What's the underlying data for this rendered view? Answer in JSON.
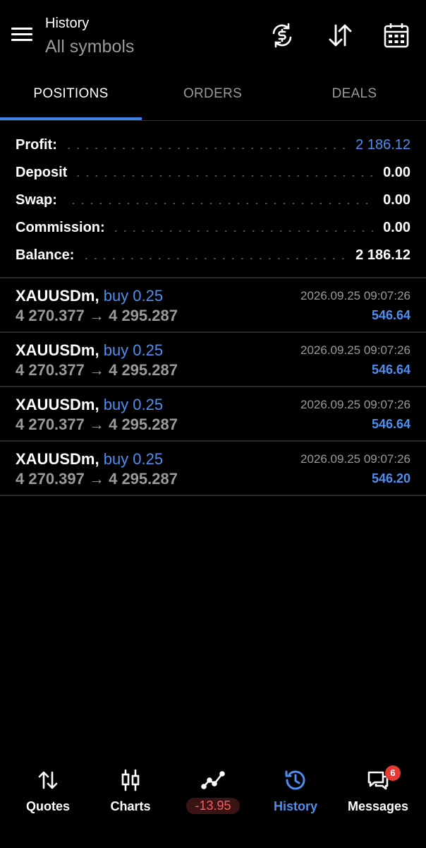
{
  "header": {
    "title": "History",
    "subtitle": "All symbols",
    "icons": [
      "menu-icon",
      "currency-exchange-icon",
      "sort-icon",
      "calendar-icon"
    ]
  },
  "tabs": [
    {
      "label": "POSITIONS",
      "active": true
    },
    {
      "label": "ORDERS",
      "active": false
    },
    {
      "label": "DEALS",
      "active": false
    }
  ],
  "summary": {
    "profit": {
      "label": "Profit:",
      "value": "2 186.12"
    },
    "deposit": {
      "label": "Deposit",
      "value": "0.00"
    },
    "swap": {
      "label": "Swap:",
      "value": "0.00"
    },
    "commission": {
      "label": "Commission:",
      "value": "0.00"
    },
    "balance": {
      "label": "Balance:",
      "value": "2 186.12"
    }
  },
  "positions": [
    {
      "symbol": "XAUUSDm,",
      "side": "buy 0.25",
      "prices": "4 270.377 → 4 295.287",
      "time": "2026.09.25 09:07:26",
      "profit": "546.64"
    },
    {
      "symbol": "XAUUSDm,",
      "side": "buy 0.25",
      "prices": "4 270.377 → 4 295.287",
      "time": "2026.09.25 09:07:26",
      "profit": "546.64"
    },
    {
      "symbol": "XAUUSDm,",
      "side": "buy 0.25",
      "prices": "4 270.377 → 4 295.287",
      "time": "2026.09.25 09:07:26",
      "profit": "546.64"
    },
    {
      "symbol": "XAUUSDm,",
      "side": "buy 0.25",
      "prices": "4 270.397 → 4 295.287",
      "time": "2026.09.25 09:07:26",
      "profit": "546.20"
    }
  ],
  "nav": {
    "quotes": "Quotes",
    "charts": "Charts",
    "trade_value": "-13.95",
    "history": "History",
    "messages": "Messages",
    "messages_badge": "6"
  },
  "colors": {
    "accent": "#4f8ff0",
    "tab_underline": "#3d7fe6",
    "negative": "#ff5a5a",
    "badge": "#e53935"
  }
}
